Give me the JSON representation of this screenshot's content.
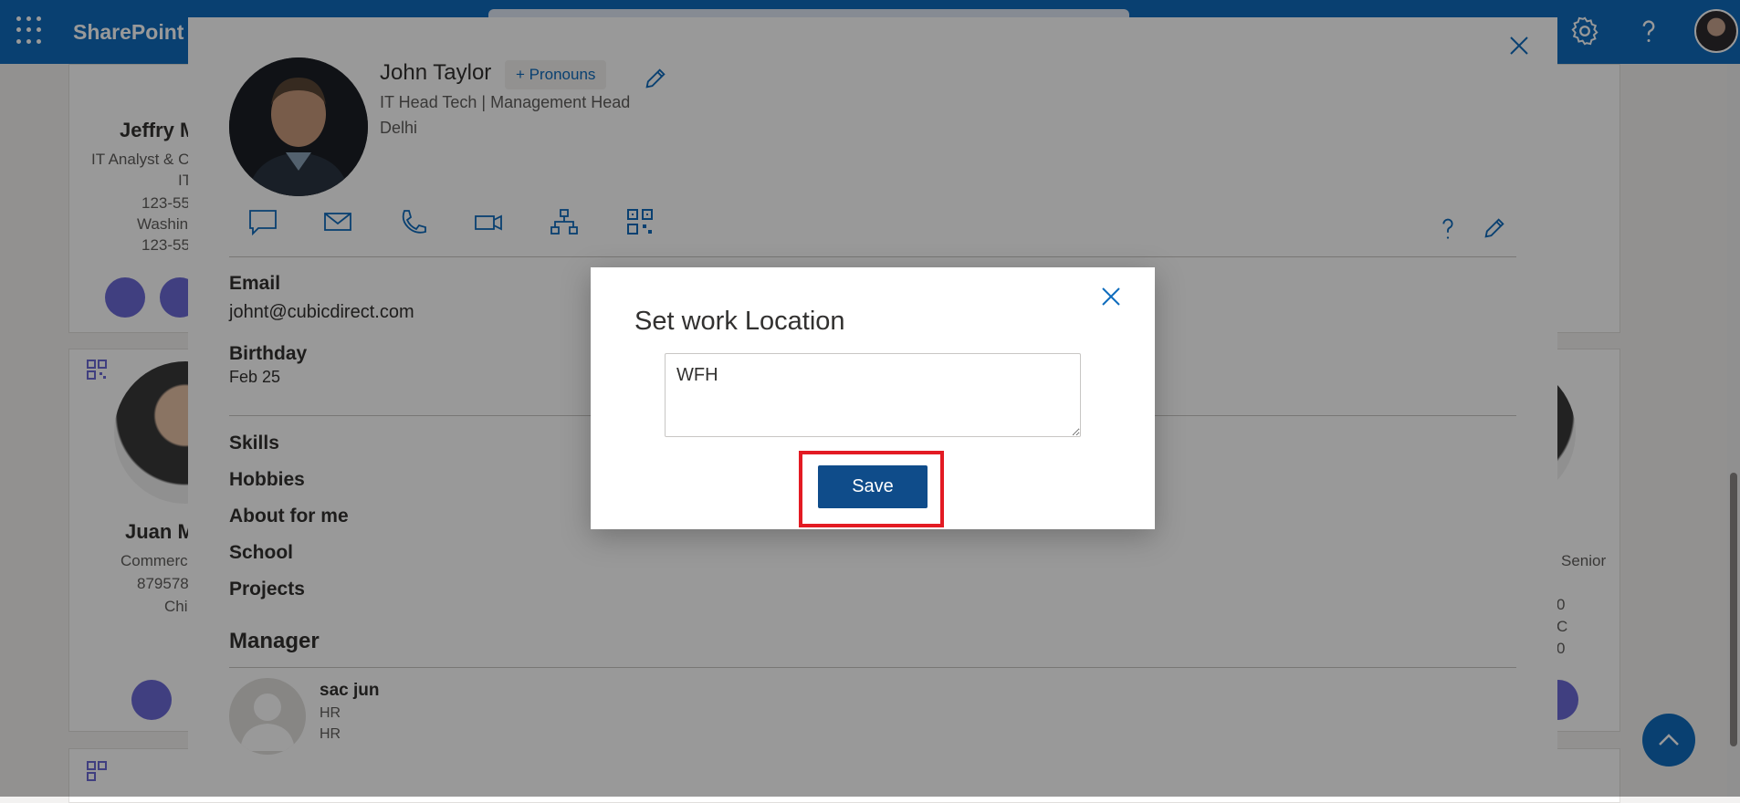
{
  "suite_bar": {
    "app_name": "SharePoint"
  },
  "background": {
    "card1": {
      "name": "Jeffry M",
      "title_line1": "IT Analyst & C",
      "title_line2": "IT",
      "phone": "123-55",
      "location": "Washin",
      "phone2": "123-55"
    },
    "card2": {
      "name": "Juan M",
      "title": "Commerc",
      "phone": "879578",
      "location": "Chi"
    },
    "card3": {
      "title": "Senior",
      "line1": "0",
      "line2": "C",
      "line3": "0"
    }
  },
  "profile": {
    "name": "John Taylor",
    "pronouns_label": "+ Pronouns",
    "job_title": "IT Head Tech",
    "separator": "|",
    "department": "Management Head",
    "city": "Delhi",
    "email_label": "Email",
    "email_value": "johnt@cubicdirect.com",
    "birthday_label": "Birthday",
    "birthday_value": "Feb 25",
    "sections": [
      "Skills",
      "Hobbies",
      "About for me",
      "School",
      "Projects"
    ],
    "manager_heading": "Manager",
    "manager": {
      "name": "sac jun",
      "line1": "HR",
      "line2": "HR"
    }
  },
  "modal": {
    "title": "Set work Location",
    "location_value": "WFH",
    "save_label": "Save"
  },
  "colors": {
    "brand": "#0f6cbd",
    "save_button": "#0f4c8a",
    "highlight": "#e31b23"
  }
}
